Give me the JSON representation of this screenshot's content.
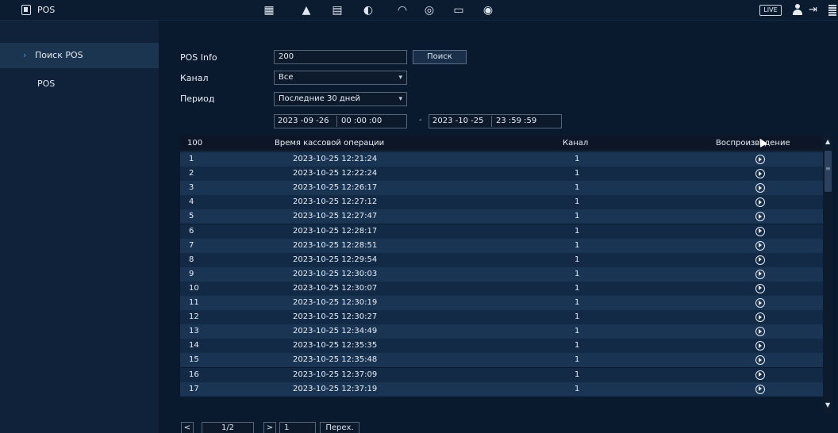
{
  "header": {
    "title": "POS",
    "live_label": "LIVE",
    "toolbar_icons": [
      "film-icon",
      "alarm-light-icon",
      "pos-icon",
      "face-icon",
      "gauge-icon",
      "target-icon",
      "monitor-icon",
      "speaker-icon"
    ]
  },
  "sidebar": {
    "items": [
      {
        "label": "Поиск POS",
        "active": true
      },
      {
        "label": "POS",
        "active": false
      }
    ]
  },
  "form": {
    "pos_info_label": "POS Info",
    "pos_info_value": "200",
    "search_button": "Поиск",
    "channel_label": "Канал",
    "channel_value": "Все",
    "period_label": "Период",
    "period_value": "Последние 30 дней",
    "start_date": "2023 -09 -26",
    "start_time": "00 :00 :00",
    "separator": "-",
    "end_date": "2023 -10 -25",
    "end_time": "23 :59 :59"
  },
  "table": {
    "headers": {
      "number": "100",
      "time": "Время кассовой операции",
      "channel": "Канал",
      "playback": "Воспроизведение"
    },
    "rows": [
      {
        "n": "1",
        "time": "2023-10-25 12:21:24",
        "ch": "1"
      },
      {
        "n": "2",
        "time": "2023-10-25 12:22:24",
        "ch": "1"
      },
      {
        "n": "3",
        "time": "2023-10-25 12:26:17",
        "ch": "1"
      },
      {
        "n": "4",
        "time": "2023-10-25 12:27:12",
        "ch": "1"
      },
      {
        "n": "5",
        "time": "2023-10-25 12:27:47",
        "ch": "1"
      },
      {
        "n": "6",
        "time": "2023-10-25 12:28:17",
        "ch": "1"
      },
      {
        "n": "7",
        "time": "2023-10-25 12:28:51",
        "ch": "1"
      },
      {
        "n": "8",
        "time": "2023-10-25 12:29:54",
        "ch": "1"
      },
      {
        "n": "9",
        "time": "2023-10-25 12:30:03",
        "ch": "1"
      },
      {
        "n": "10",
        "time": "2023-10-25 12:30:07",
        "ch": "1"
      },
      {
        "n": "11",
        "time": "2023-10-25 12:30:19",
        "ch": "1"
      },
      {
        "n": "12",
        "time": "2023-10-25 12:30:27",
        "ch": "1"
      },
      {
        "n": "13",
        "time": "2023-10-25 12:34:49",
        "ch": "1"
      },
      {
        "n": "14",
        "time": "2023-10-25 12:35:35",
        "ch": "1"
      },
      {
        "n": "15",
        "time": "2023-10-25 12:35:48",
        "ch": "1"
      },
      {
        "n": "16",
        "time": "2023-10-25 12:37:09",
        "ch": "1"
      },
      {
        "n": "17",
        "time": "2023-10-25 12:37:19",
        "ch": "1"
      }
    ]
  },
  "pager": {
    "prev": "<",
    "page": "1/2",
    "next": ">",
    "goto_value": "1",
    "goto_button": "Перех."
  }
}
